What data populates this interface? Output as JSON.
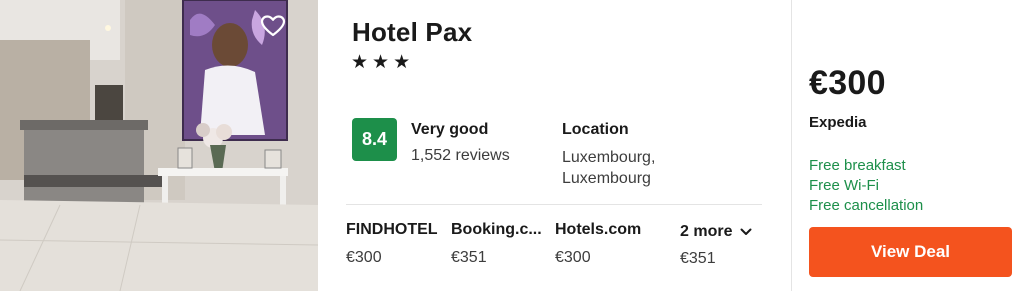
{
  "hotel": {
    "name": "Hotel Pax",
    "stars": [
      "★",
      "★",
      "★"
    ]
  },
  "rating": {
    "score": "8.4",
    "label": "Very good",
    "reviews": "1,552 reviews",
    "badge_color": "#1d8f4a"
  },
  "location": {
    "title": "Location",
    "line1": "Luxembourg,",
    "line2": "Luxembourg"
  },
  "providers": [
    {
      "name": "FINDHOTEL",
      "price": "€300"
    },
    {
      "name": "Booking.c...",
      "price": "€351"
    },
    {
      "name": "Hotels.com",
      "price": "€300"
    }
  ],
  "more": {
    "label": "2 more",
    "price": "€351",
    "icon": "chevron-down-icon"
  },
  "deal": {
    "price": "€300",
    "provider": "Expedia",
    "amenities": [
      "Free breakfast",
      "Free Wi-Fi",
      "Free cancellation"
    ],
    "button_label": "View Deal",
    "button_color": "#f4531e",
    "amenity_color": "#1d8f4a"
  },
  "photo": {
    "favorite_icon": "heart-icon"
  }
}
